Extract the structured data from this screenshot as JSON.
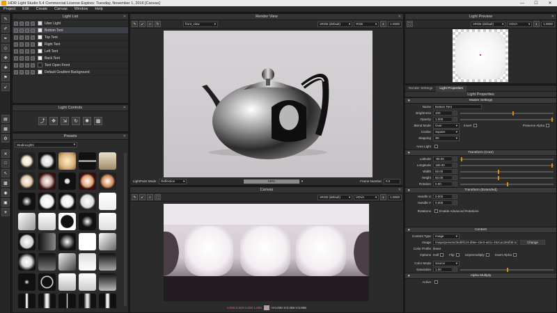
{
  "window": {
    "title": "HDR Light Studio 5.4 Commercial License Expires: Tuesday, November 1, 2016 [Canvas]",
    "minimize": "—",
    "maximize": "☐",
    "close": "✕"
  },
  "menu": [
    "Project",
    "Edit",
    "Create",
    "Canvas",
    "Window",
    "Help"
  ],
  "light_list": {
    "title": "Light List",
    "items": [
      {
        "label": "Uber Light",
        "swatch": "#d8d8d8",
        "selected": false
      },
      {
        "label": "Bottom Tent",
        "swatch": "#e8e8e8",
        "selected": true
      },
      {
        "label": "Top Tent",
        "swatch": "#f0f0f0",
        "selected": false
      },
      {
        "label": "Right Tent",
        "swatch": "#f3f3f3",
        "selected": false
      },
      {
        "label": "Left Tent",
        "swatch": "#f3f3f3",
        "selected": false
      },
      {
        "label": "Back Tent",
        "swatch": "#f3f3f3",
        "selected": false
      },
      {
        "label": "Tent Open Front",
        "swatch": "#202020",
        "selected": false
      },
      {
        "label": "Default Gradient Background",
        "swatch": "#f5f5f5",
        "selected": false
      }
    ]
  },
  "light_controls": {
    "title": "Light Controls"
  },
  "presets": {
    "title": "Presets",
    "category": "StudioLights"
  },
  "render_view": {
    "title": "Render View",
    "camera": "front_view",
    "colorspace": "sRGB (default)",
    "channel": "RGB",
    "value": "1.0000",
    "mode_label": "LightPaint Mode",
    "mode_value": "Reflection",
    "zoom": "100%",
    "frame_label": "Frame Number",
    "frame_value": "0.0"
  },
  "canvas": {
    "title": "Canvas",
    "colorspace": "sRGB (default)",
    "channel": "HDVA",
    "value": "1.0000",
    "status_rgb": "0.000  0.000  0.000  1.000",
    "status_hsv": "H:0.030  S:0.268  V:0.696"
  },
  "light_preview": {
    "title": "Light Preview",
    "colorspace": "sRGB (default)",
    "channel": "HDVA",
    "value": "1.0000"
  },
  "properties": {
    "tabs": [
      "Render Settings",
      "Light Properties"
    ],
    "active_tab": "Light Properties",
    "title": "Light Properties",
    "sections": {
      "master": "Master Settings",
      "transform_core": "Transform (Core)",
      "transform_ext": "Transform (Extended)",
      "content": "Content",
      "alpha": "Alpha Multiply"
    },
    "name_label": "Name",
    "name": "Bottom Tent",
    "brightness_label": "Brightness",
    "brightness": "100",
    "opacity_label": "Opacity",
    "opacity": "1.000",
    "blend_label": "Blend Mode",
    "blend": "Over",
    "invert_label": "Invert",
    "preserve_alpha_label": "Preserve Alpha",
    "cookie_label": "Cookie",
    "cookie": "Square",
    "mapping_label": "Mapping",
    "mapping": "3D",
    "area_light_label": "Area Light",
    "latitude_label": "Latitude",
    "latitude": "-90.00",
    "longitude_label": "Longitude",
    "longitude": "180.00",
    "width_label": "Width",
    "width": "50.00",
    "height_label": "Height",
    "height": "50.00",
    "rotation_label": "Rotation",
    "rotation": "0.00",
    "handle_u_label": "Handle U",
    "handle_u": "0.000",
    "handle_v_label": "Handle V",
    "handle_v": "0.000",
    "rotations_label": "Rotations",
    "adv_rot_label": "Enable Advanced Rotations",
    "content_type_label": "Content Type",
    "content_type": "Image",
    "image_label": "Image",
    "image": "/maps/presets/3ed0f124-d86e-43e3-a611-452ca1384f38.tx",
    "change_label": "Change",
    "color_profile_label": "Color Profile",
    "color_profile": "linear",
    "options_label": "Options",
    "half_label": "Half",
    "flip_label": "Flip",
    "unpremultiply_label": "Unpremultiply",
    "invert_alpha_label": "Invert Alpha",
    "color_mode_label": "Color Mode",
    "color_mode": "Source",
    "saturation_label": "Saturation",
    "saturation": "1.00",
    "active_label": "Active"
  },
  "colors": {
    "accent": "#e08a10",
    "panel": "#2b2b2b",
    "selection": "#3d4048"
  }
}
